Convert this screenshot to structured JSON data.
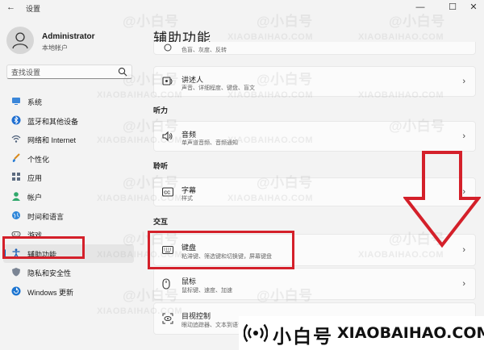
{
  "window": {
    "title": "设置",
    "back_glyph": "←",
    "minimize_glyph": "—",
    "maximize_glyph": "☐",
    "close_glyph": "✕"
  },
  "profile": {
    "name": "Administrator",
    "account_type": "本地帐户"
  },
  "search": {
    "placeholder": "查找设置"
  },
  "nav": {
    "items": [
      {
        "label": "系统",
        "icon": "monitor-icon"
      },
      {
        "label": "蓝牙和其他设备",
        "icon": "bluetooth-icon"
      },
      {
        "label": "网络和 Internet",
        "icon": "wifi-icon"
      },
      {
        "label": "个性化",
        "icon": "brush-icon"
      },
      {
        "label": "应用",
        "icon": "apps-icon"
      },
      {
        "label": "帐户",
        "icon": "account-icon"
      },
      {
        "label": "时间和语言",
        "icon": "globe-icon"
      },
      {
        "label": "游戏",
        "icon": "gamepad-icon"
      },
      {
        "label": "辅助功能",
        "icon": "accessibility-icon"
      },
      {
        "label": "隐私和安全性",
        "icon": "shield-icon"
      },
      {
        "label": "Windows 更新",
        "icon": "update-icon"
      }
    ],
    "active_index": 8
  },
  "main": {
    "title": "辅助功能",
    "top_card": {
      "subtitle": "色盲、灰度、反转"
    },
    "narrator": {
      "title": "讲述人",
      "subtitle": "声音、详细程度、键盘、盲文"
    },
    "sections": {
      "hearing": "听力",
      "listening": "聆听",
      "interaction": "交互"
    },
    "audio": {
      "title": "音频",
      "subtitle": "单声道音频、音频通知"
    },
    "captions": {
      "title": "字幕",
      "subtitle": "样式"
    },
    "keyboard": {
      "title": "键盘",
      "subtitle": "粘滞键、筛选键和切换键，屏幕键盘"
    },
    "mouse": {
      "title": "鼠标",
      "subtitle": "鼠标键、速度、加速"
    },
    "eye_control": {
      "title": "目视控制",
      "subtitle": "眼动追踪器、文本到语音转换"
    },
    "chevron": "›"
  },
  "watermark": {
    "cn": "@小白号",
    "en": "XIAOBAIHAO.COM"
  },
  "brand": {
    "cn": "小白号",
    "en": "XIAOBAIHAO.COM"
  },
  "colors": {
    "accent": "#0067c0",
    "highlight_red": "#d4202a"
  }
}
